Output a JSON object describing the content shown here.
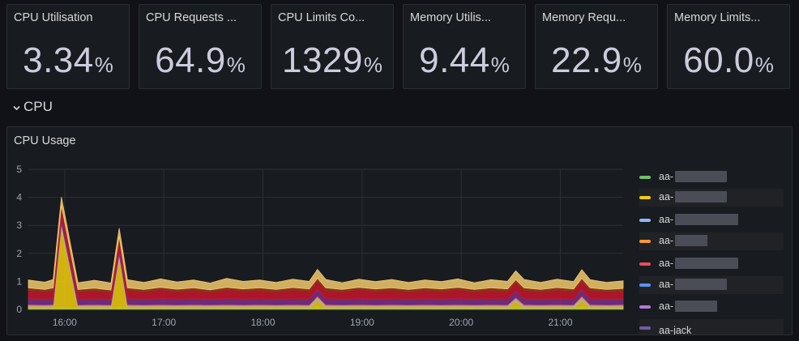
{
  "stats": [
    {
      "title": "CPU Utilisation",
      "value": "3.34",
      "unit": "%"
    },
    {
      "title": "CPU Requests ...",
      "value": "64.9",
      "unit": "%"
    },
    {
      "title": "CPU Limits Co...",
      "value": "1329",
      "unit": "%"
    },
    {
      "title": "Memory Utilis...",
      "value": "9.44",
      "unit": "%"
    },
    {
      "title": "Memory Requ...",
      "value": "22.9",
      "unit": "%"
    },
    {
      "title": "Memory Limits...",
      "value": "60.0",
      "unit": "%"
    }
  ],
  "row": {
    "label": "CPU",
    "chevron_icon": "chevron-down-icon"
  },
  "panel": {
    "title": "CPU Usage"
  },
  "chart_data": {
    "type": "area",
    "stacked": true,
    "title": "CPU Usage",
    "x_ticks": [
      "16:00",
      "17:00",
      "18:00",
      "19:00",
      "20:00",
      "21:00"
    ],
    "y_ticks": [
      "0",
      "1",
      "2",
      "3",
      "4",
      "5"
    ],
    "ylim": [
      0,
      5
    ],
    "x": [
      "15:38",
      "15:48",
      "15:53",
      "15:58",
      "16:08",
      "16:18",
      "16:28",
      "16:33",
      "16:38",
      "16:48",
      "16:58",
      "17:08",
      "17:18",
      "17:28",
      "17:38",
      "17:48",
      "17:58",
      "18:08",
      "18:18",
      "18:28",
      "18:33",
      "18:38",
      "18:48",
      "18:58",
      "19:08",
      "19:18",
      "19:28",
      "19:38",
      "19:48",
      "19:58",
      "20:08",
      "20:18",
      "20:28",
      "20:33",
      "20:38",
      "20:48",
      "20:58",
      "21:08",
      "21:13",
      "21:18",
      "21:28",
      "21:38"
    ],
    "grid": true,
    "legend_placement": "right",
    "series": [
      {
        "color": "#73bf69",
        "values": [
          0.04,
          0.04,
          0.04,
          0.05,
          0.04,
          0.04,
          0.04,
          0.05,
          0.04,
          0.04,
          0.04,
          0.04,
          0.04,
          0.04,
          0.04,
          0.04,
          0.04,
          0.04,
          0.04,
          0.04,
          0.05,
          0.04,
          0.04,
          0.04,
          0.04,
          0.04,
          0.04,
          0.04,
          0.04,
          0.04,
          0.04,
          0.04,
          0.04,
          0.05,
          0.04,
          0.04,
          0.04,
          0.04,
          0.05,
          0.04,
          0.04,
          0.04
        ]
      },
      {
        "color": "#f2cc0c",
        "values": [
          0.02,
          0.02,
          0.02,
          2.9,
          0.02,
          0.02,
          0.02,
          1.8,
          0.02,
          0.02,
          0.02,
          0.02,
          0.02,
          0.02,
          0.02,
          0.02,
          0.02,
          0.02,
          0.02,
          0.02,
          0.3,
          0.02,
          0.02,
          0.02,
          0.02,
          0.02,
          0.02,
          0.02,
          0.02,
          0.02,
          0.02,
          0.02,
          0.02,
          0.25,
          0.02,
          0.02,
          0.02,
          0.02,
          0.3,
          0.02,
          0.02,
          0.02
        ]
      },
      {
        "color": "#8ab8ff",
        "values": [
          0.05,
          0.05,
          0.05,
          0.06,
          0.05,
          0.05,
          0.05,
          0.06,
          0.05,
          0.05,
          0.05,
          0.05,
          0.05,
          0.05,
          0.05,
          0.05,
          0.05,
          0.05,
          0.05,
          0.05,
          0.06,
          0.05,
          0.05,
          0.05,
          0.05,
          0.05,
          0.05,
          0.05,
          0.05,
          0.05,
          0.05,
          0.05,
          0.05,
          0.06,
          0.05,
          0.05,
          0.05,
          0.05,
          0.06,
          0.05,
          0.05,
          0.05
        ]
      },
      {
        "color": "#ff9830",
        "values": [
          0.06,
          0.05,
          0.06,
          0.06,
          0.05,
          0.06,
          0.05,
          0.06,
          0.06,
          0.05,
          0.06,
          0.05,
          0.06,
          0.05,
          0.06,
          0.05,
          0.06,
          0.05,
          0.06,
          0.05,
          0.06,
          0.06,
          0.05,
          0.06,
          0.05,
          0.06,
          0.05,
          0.06,
          0.05,
          0.06,
          0.05,
          0.06,
          0.05,
          0.06,
          0.06,
          0.05,
          0.06,
          0.05,
          0.06,
          0.06,
          0.05,
          0.06
        ]
      },
      {
        "color": "#7c2e8a",
        "values": [
          0.22,
          0.2,
          0.22,
          0.24,
          0.2,
          0.22,
          0.19,
          0.24,
          0.22,
          0.2,
          0.23,
          0.21,
          0.22,
          0.2,
          0.23,
          0.21,
          0.22,
          0.2,
          0.22,
          0.21,
          0.24,
          0.22,
          0.2,
          0.23,
          0.21,
          0.22,
          0.2,
          0.22,
          0.21,
          0.23,
          0.2,
          0.22,
          0.21,
          0.24,
          0.22,
          0.2,
          0.22,
          0.21,
          0.24,
          0.22,
          0.2,
          0.21
        ]
      },
      {
        "color": "#c4162a",
        "values": [
          0.3,
          0.28,
          0.3,
          0.32,
          0.28,
          0.29,
          0.27,
          0.31,
          0.3,
          0.28,
          0.31,
          0.28,
          0.3,
          0.27,
          0.31,
          0.29,
          0.3,
          0.28,
          0.31,
          0.29,
          0.32,
          0.3,
          0.28,
          0.31,
          0.29,
          0.3,
          0.28,
          0.3,
          0.29,
          0.31,
          0.28,
          0.3,
          0.29,
          0.32,
          0.3,
          0.28,
          0.31,
          0.29,
          0.32,
          0.3,
          0.28,
          0.29
        ]
      },
      {
        "color": "#8f3b1b",
        "values": [
          0.08,
          0.07,
          0.08,
          0.08,
          0.07,
          0.08,
          0.07,
          0.08,
          0.08,
          0.07,
          0.08,
          0.07,
          0.08,
          0.07,
          0.08,
          0.07,
          0.08,
          0.07,
          0.08,
          0.07,
          0.08,
          0.08,
          0.07,
          0.08,
          0.07,
          0.08,
          0.07,
          0.08,
          0.07,
          0.08,
          0.07,
          0.08,
          0.07,
          0.08,
          0.08,
          0.07,
          0.08,
          0.07,
          0.08,
          0.08,
          0.07,
          0.08
        ]
      },
      {
        "color": "#f2c96d",
        "values": [
          0.28,
          0.26,
          0.3,
          0.3,
          0.24,
          0.28,
          0.25,
          0.3,
          0.29,
          0.25,
          0.3,
          0.26,
          0.28,
          0.24,
          0.32,
          0.27,
          0.28,
          0.25,
          0.3,
          0.27,
          0.32,
          0.3,
          0.24,
          0.29,
          0.26,
          0.3,
          0.25,
          0.28,
          0.26,
          0.3,
          0.24,
          0.29,
          0.27,
          0.32,
          0.3,
          0.25,
          0.3,
          0.26,
          0.31,
          0.29,
          0.25,
          0.27
        ]
      }
    ],
    "legend": [
      {
        "label": "aa-",
        "color": "#73bf69"
      },
      {
        "label": "aa-",
        "color": "#f2cc0c"
      },
      {
        "label": "aa-",
        "color": "#8ab8ff"
      },
      {
        "label": "aa-",
        "color": "#ff9830"
      },
      {
        "label": "aa-",
        "color": "#f2495c"
      },
      {
        "label": "aa-",
        "color": "#5794f2"
      },
      {
        "label": "aa-",
        "color": "#b877d9"
      },
      {
        "label": "aa-jack",
        "color": "#705da0"
      }
    ]
  }
}
